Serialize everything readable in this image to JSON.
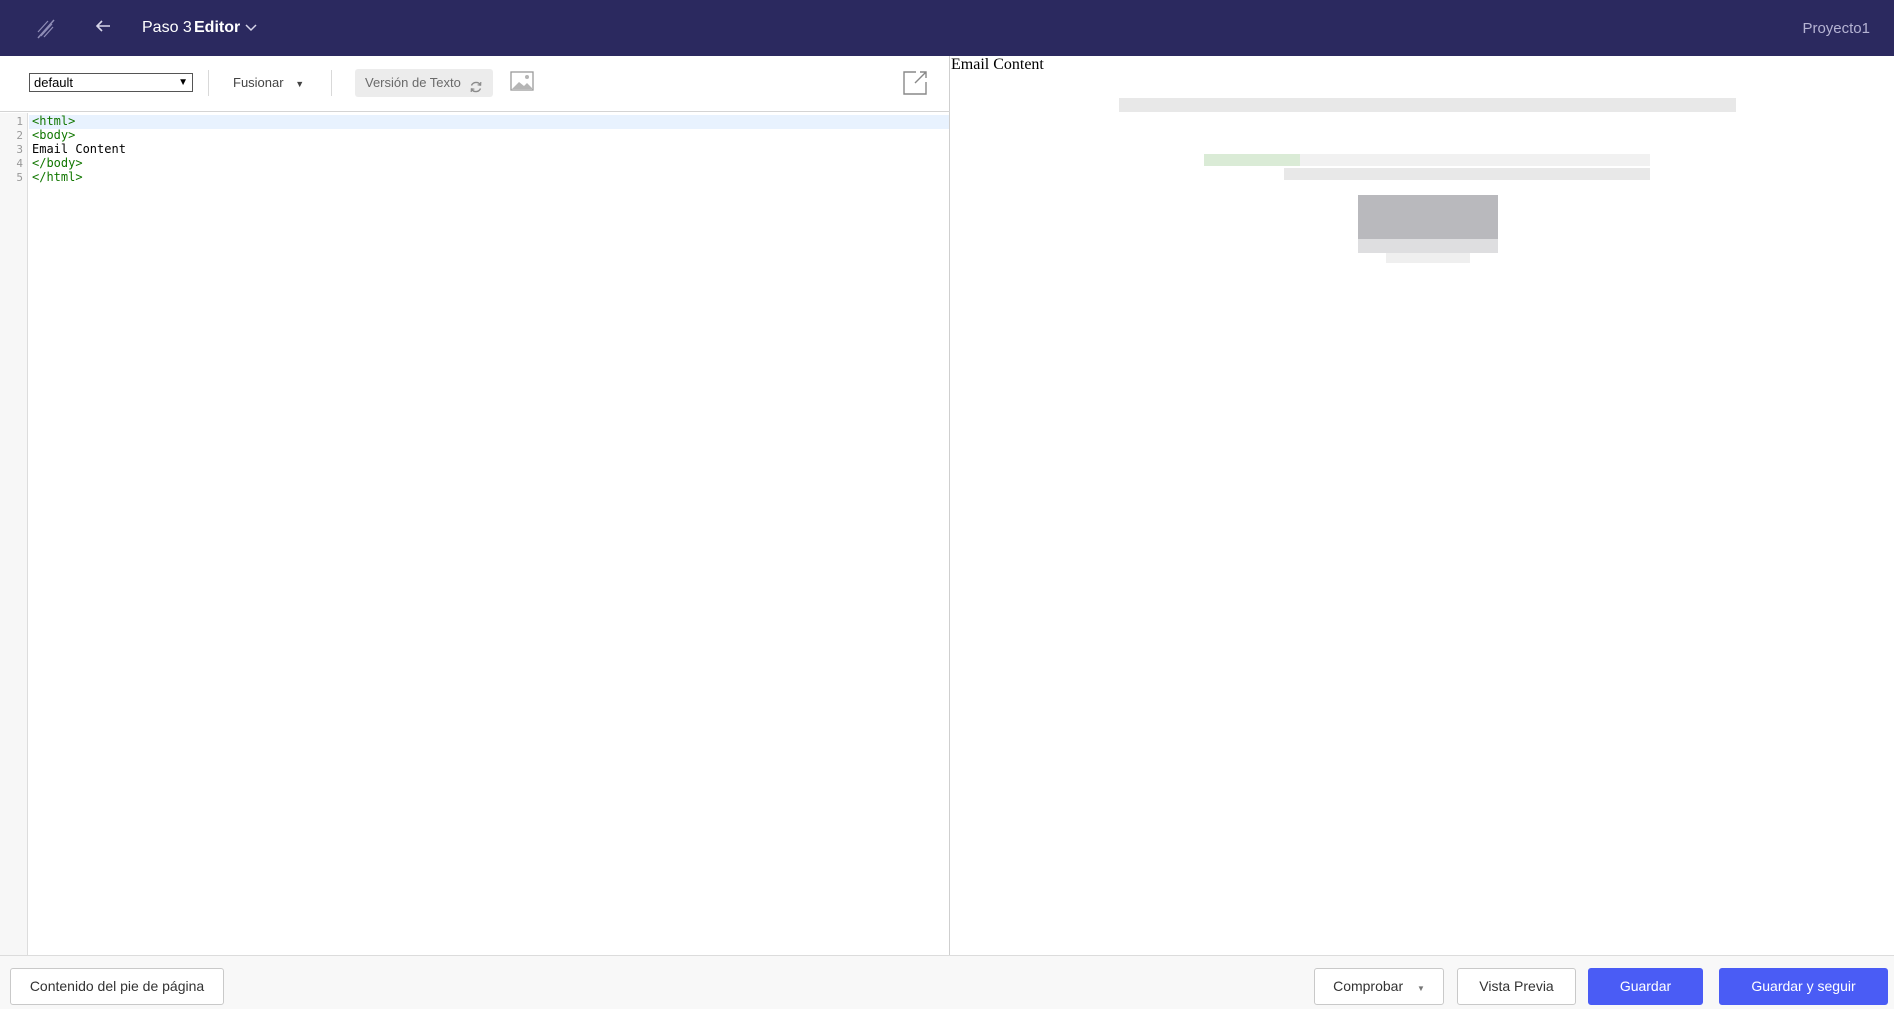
{
  "header": {
    "step_label": "Paso 3",
    "current_label": "Editor",
    "project_name": "Proyecto1"
  },
  "toolbar": {
    "template_select_value": "default",
    "merge_label": "Fusionar",
    "text_version_label": "Versión de Texto"
  },
  "editor": {
    "line_numbers": [
      "1",
      "2",
      "3",
      "4",
      "5"
    ],
    "lines": [
      "<html>",
      "<body>",
      "Email Content",
      "</body>",
      "</html>"
    ]
  },
  "preview": {
    "content_text": "Email Content"
  },
  "footer": {
    "footer_content_label": "Contenido del pie de página",
    "check_label": "Comprobar",
    "preview_label": "Vista Previa",
    "save_label": "Guardar",
    "save_continue_label": "Guardar y seguir"
  },
  "colors": {
    "topbar_bg": "#2b295f",
    "primary_button": "#4a5cf5",
    "code_tag": "#117700"
  },
  "icons": {
    "logo": "feather-logo-icon",
    "back": "arrow-left-icon",
    "chevron": "chevron-down-icon",
    "sync": "sync-icon",
    "image": "image-icon",
    "popout": "external-link-icon"
  }
}
